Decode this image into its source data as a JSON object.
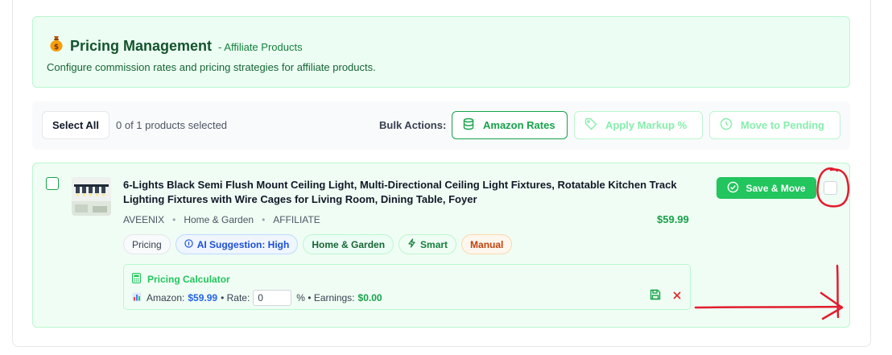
{
  "banner": {
    "icon": "money-bag-icon",
    "title": "Pricing Management",
    "subtitle": "- Affiliate Products",
    "description": "Configure commission rates and pricing strategies for affiliate products."
  },
  "toolbar": {
    "select_all_label": "Select All",
    "selection_count": "0 of 1 products selected",
    "bulk_label": "Bulk Actions:",
    "amazon_rates_label": "Amazon Rates",
    "apply_markup_label": "Apply Markup %",
    "move_pending_label": "Move to Pending"
  },
  "product": {
    "title": "6-Lights Black Semi Flush Mount Ceiling Light, Multi-Directional Ceiling Light Fixtures, Rotatable Kitchen Track Lighting Fixtures with Wire Cages for Living Room, Dining Table, Foyer",
    "brand": "AVEENIX",
    "category": "Home & Garden",
    "type": "AFFILIATE",
    "price": "$59.99",
    "save_label": "Save & Move",
    "tags": {
      "pricing": "Pricing",
      "ai": "AI Suggestion: High",
      "category": "Home & Garden",
      "smart": "Smart",
      "manual": "Manual"
    },
    "calculator": {
      "title": "Pricing Calculator",
      "amazon_label": "Amazon:",
      "amazon_value": "$59.99",
      "rate_label": "• Rate:",
      "rate_value": "0",
      "percent_label": "% • Earnings:",
      "earnings_value": "$0.00"
    }
  },
  "colors": {
    "accent": "#16a34a",
    "banner_bg": "#ecfdf3",
    "annotation": "#e11d2e"
  }
}
